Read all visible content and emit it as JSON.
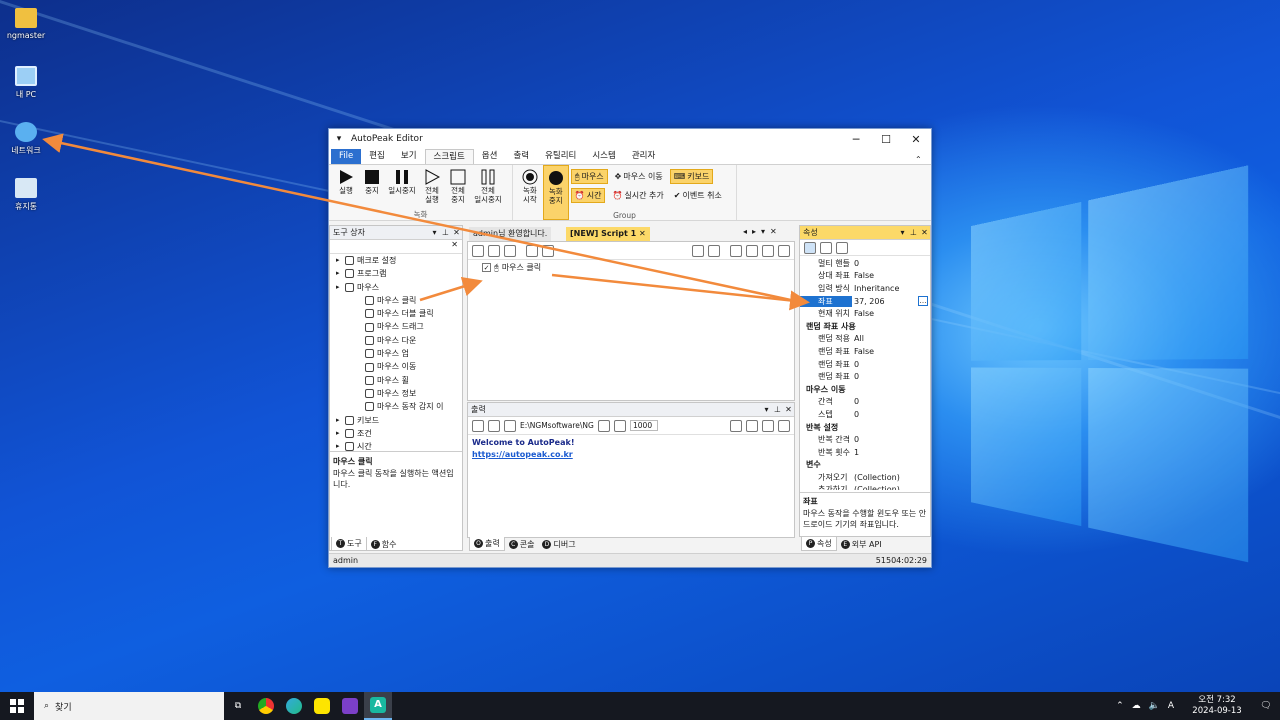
{
  "desktop": {
    "icons": [
      {
        "label": "ngmaster",
        "icon": "user-folder-icon"
      },
      {
        "label": "내 PC",
        "icon": "computer-icon"
      },
      {
        "label": "네트워크",
        "icon": "network-icon"
      },
      {
        "label": "휴지통",
        "icon": "recycle-bin-icon"
      }
    ]
  },
  "window": {
    "title": "AutoPeak Editor",
    "menu_tabs": [
      "File",
      "편집",
      "보기",
      "스크립트",
      "옵션",
      "출력",
      "유틸리티",
      "시스템",
      "관리자"
    ],
    "active_tab": "스크립트",
    "ribbon": {
      "run_group": [
        {
          "label": "실행",
          "icon": "play-icon"
        },
        {
          "label": "중지",
          "icon": "stop-icon"
        },
        {
          "label": "일시중지",
          "icon": "pause-icon"
        },
        {
          "label": "전체\n실행",
          "icon": "play-outline-icon"
        },
        {
          "label": "전체\n중지",
          "icon": "stop-outline-icon"
        },
        {
          "label": "전체\n일시중지",
          "icon": "pause-outline-icon"
        }
      ],
      "run_group_label": "녹화",
      "record_group": [
        {
          "label": "녹화\n시작",
          "icon": "record-start-icon"
        },
        {
          "label": "녹화\n중지",
          "icon": "record-stop-icon"
        }
      ],
      "record_options": [
        {
          "label": "마우스",
          "icon": "mouse-icon",
          "on": true
        },
        {
          "label": "마우스 이동",
          "icon": "mouse-move-icon",
          "on": false
        },
        {
          "label": "키보드",
          "icon": "keyboard-icon",
          "on": true
        },
        {
          "label": "시간",
          "icon": "clock-icon",
          "on": true
        },
        {
          "label": "실시간 추가",
          "icon": "realtime-icon",
          "on": false
        },
        {
          "label": "이벤트 취소",
          "icon": "cancel-event-icon",
          "on": false
        }
      ],
      "record_group_label": "Group"
    },
    "toolbox": {
      "title": "도구 상자",
      "items": [
        {
          "label": "매크로 설정",
          "level": 0
        },
        {
          "label": "프로그램",
          "level": 0
        },
        {
          "label": "마우스",
          "level": 0
        },
        {
          "label": "마우스 클릭",
          "level": 1
        },
        {
          "label": "마우스 더블 클릭",
          "level": 1
        },
        {
          "label": "마우스 드래그",
          "level": 1
        },
        {
          "label": "마우스 다운",
          "level": 1
        },
        {
          "label": "마우스 업",
          "level": 1
        },
        {
          "label": "마우스 이동",
          "level": 1
        },
        {
          "label": "마우스 휠",
          "level": 1
        },
        {
          "label": "마우스 정보",
          "level": 1
        },
        {
          "label": "마우스 동작 감지 이",
          "level": 1
        },
        {
          "label": "키보드",
          "level": 0
        },
        {
          "label": "조건",
          "level": 0
        },
        {
          "label": "시간",
          "level": 0
        }
      ],
      "desc_title": "마우스 클릭",
      "desc_text": "마우스 클릭 동작을 실행하는 액션입니다.",
      "bottom_tabs": [
        {
          "key": "T",
          "label": "도구"
        },
        {
          "key": "F",
          "label": "함수"
        }
      ]
    },
    "editor": {
      "tabs": [
        "admin님 환영합니다.",
        "[NEW] Script 1"
      ],
      "script_items": [
        "마우스 클릭"
      ]
    },
    "output": {
      "title": "출력",
      "path": "E:\\NGMsoftware\\NG",
      "count": "1000",
      "lines": [
        "Welcome to AutoPeak!",
        "https://autopeak.co.kr"
      ],
      "bottom_tabs": [
        {
          "key": "O",
          "label": "출력"
        },
        {
          "key": "C",
          "label": "콘솔"
        },
        {
          "key": "D",
          "label": "디버그"
        }
      ]
    },
    "properties": {
      "title": "속성",
      "rows": [
        {
          "k": "멀티 핸들",
          "v": "0"
        },
        {
          "k": "상대 좌표",
          "v": "False"
        },
        {
          "k": "입력 방식",
          "v": "Inheritance"
        },
        {
          "k": "좌표",
          "v": "37, 206",
          "sel": true
        },
        {
          "k": "현재 위치",
          "v": "False"
        },
        {
          "k": "랜덤 좌표 사용",
          "v": "",
          "cat": true
        },
        {
          "k": "랜덤 적용",
          "v": "All"
        },
        {
          "k": "랜덤 좌표",
          "v": "False"
        },
        {
          "k": "랜덤 좌표",
          "v": "0"
        },
        {
          "k": "랜덤 좌표",
          "v": "0"
        },
        {
          "k": "마우스 이동",
          "v": "",
          "cat": true
        },
        {
          "k": "간격",
          "v": "0"
        },
        {
          "k": "스텝",
          "v": "0"
        },
        {
          "k": "반복 설정",
          "v": "",
          "cat": true
        },
        {
          "k": "반복 간격",
          "v": "0"
        },
        {
          "k": "반복 횟수",
          "v": "1"
        },
        {
          "k": "변수",
          "v": "",
          "cat": true
        },
        {
          "k": "가져오기",
          "v": "(Collection)"
        },
        {
          "k": "추가하기",
          "v": "(Collection)"
        }
      ],
      "desc_title": "좌표",
      "desc_text": "마우스 동작을 수행할 윈도우 또는 안드로이드 기기의 좌표입니다.",
      "bottom_tabs": [
        {
          "key": "P",
          "label": "속성"
        },
        {
          "key": "E",
          "label": "외부 API"
        }
      ]
    },
    "status": {
      "user": "admin",
      "time": "51504:02:29"
    }
  },
  "taskbar": {
    "search_placeholder": "찾기",
    "apps": [
      "task-view-icon",
      "chrome-icon",
      "edge-icon",
      "kakaotalk-icon",
      "visual-studio-icon",
      "autopeak-icon"
    ],
    "clock_time": "오전 7:32",
    "clock_date": "2024-09-13"
  },
  "colors": {
    "accent": "#2b6fcf",
    "highlight": "#fbd36a",
    "arrow": "#f28a3c",
    "selection": "#1e72d0"
  }
}
